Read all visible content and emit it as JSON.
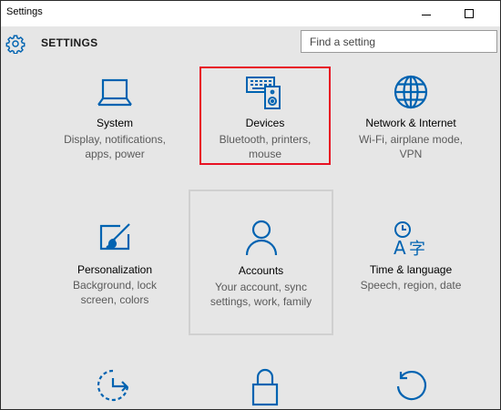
{
  "window": {
    "title": "Settings"
  },
  "header": {
    "title": "SETTINGS"
  },
  "search": {
    "placeholder": "Find a setting"
  },
  "tiles": [
    {
      "label": "System",
      "line1": "Display, notifications,",
      "line2": "apps, power",
      "icon": "laptop-icon"
    },
    {
      "label": "Devices",
      "line1": "Bluetooth, printers,",
      "line2": "mouse",
      "icon": "devices-icon"
    },
    {
      "label": "Network & Internet",
      "line1": "Wi-Fi, airplane mode,",
      "line2": "VPN",
      "icon": "globe-icon"
    },
    {
      "label": "Personalization",
      "line1": "Background, lock",
      "line2": "screen, colors",
      "icon": "paintbrush-icon"
    },
    {
      "label": "Accounts",
      "line1": "Your account, sync",
      "line2": "settings, work, family",
      "icon": "person-icon"
    },
    {
      "label": "Time & language",
      "line1": "Speech, region, date",
      "line2": "",
      "icon": "time-language-icon"
    },
    {
      "label": "",
      "line1": "",
      "line2": "",
      "icon": "ease-of-access-icon"
    },
    {
      "label": "",
      "line1": "",
      "line2": "",
      "icon": "lock-icon"
    },
    {
      "label": "",
      "line1": "",
      "line2": "",
      "icon": "update-security-icon"
    }
  ],
  "colors": {
    "accent": "#0063b1",
    "highlight_border": "#e81123",
    "background": "#e6e6e6"
  }
}
